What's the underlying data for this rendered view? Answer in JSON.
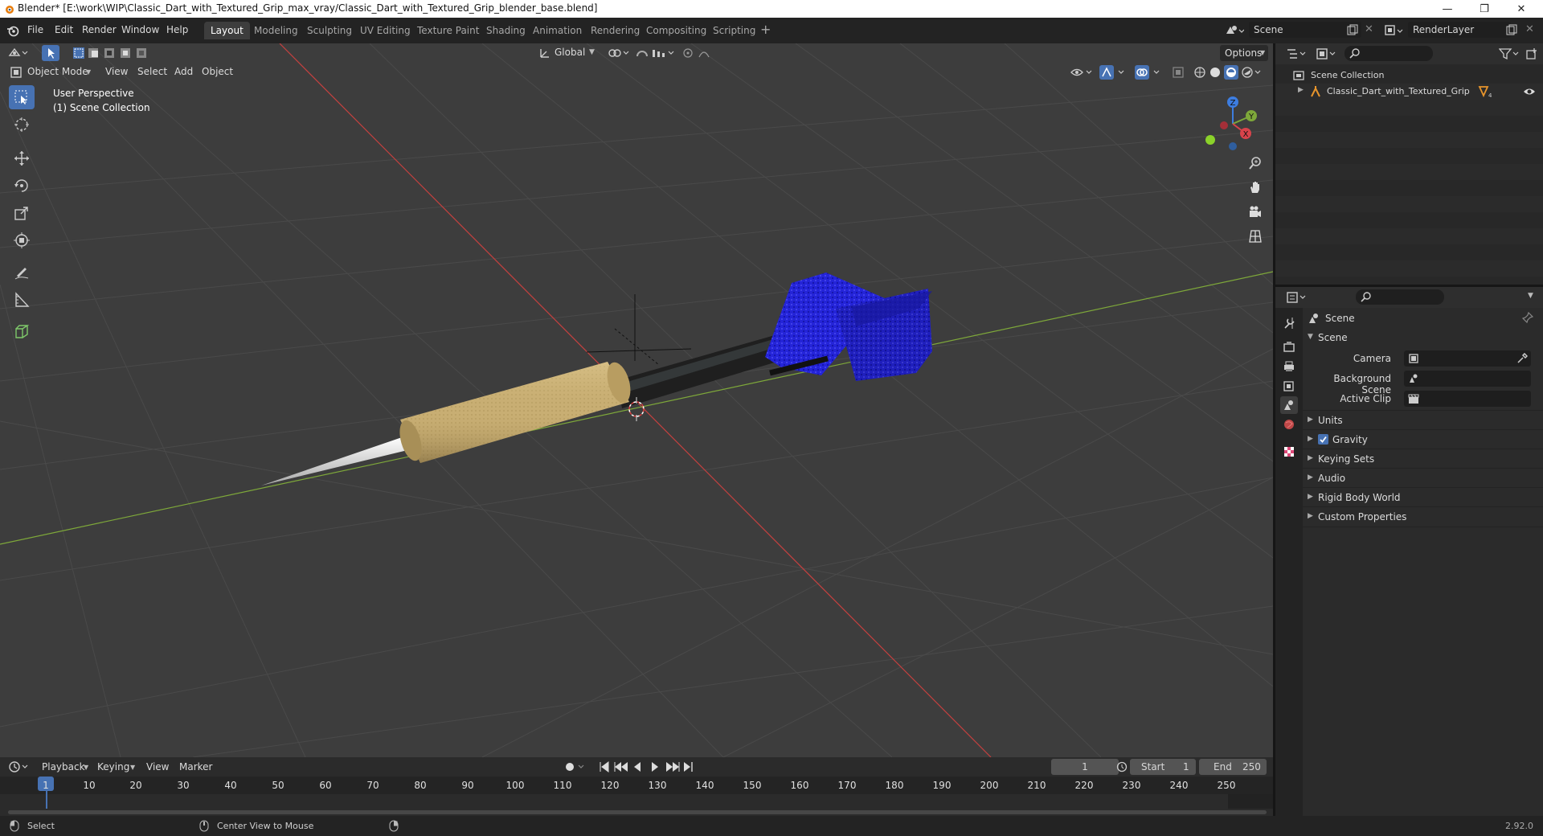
{
  "window": {
    "title": "Blender* [E:\\work\\WIP\\Classic_Dart_with_Textured_Grip_max_vray/Classic_Dart_with_Textured_Grip_blender_base.blend]",
    "controls": [
      "—",
      "❐",
      "✕"
    ]
  },
  "menu": {
    "items": [
      "File",
      "Edit",
      "Render",
      "Window",
      "Help"
    ]
  },
  "workspaces": {
    "tabs": [
      "Layout",
      "Modeling",
      "Sculpting",
      "UV Editing",
      "Texture Paint",
      "Shading",
      "Animation",
      "Rendering",
      "Compositing",
      "Scripting"
    ],
    "active": "Layout",
    "add_symbol": "+"
  },
  "scene_selector": {
    "value": "Scene"
  },
  "render_layer": {
    "value": "RenderLayer"
  },
  "viewport": {
    "mode": "Object Mode",
    "menus": [
      "View",
      "Select",
      "Add",
      "Object"
    ],
    "transform_orientation": "Global",
    "options_label": "Options",
    "overlay_line1": "User Perspective",
    "overlay_line2": "(1) Scene Collection",
    "gizmo_axes": {
      "z": "Z",
      "y": "Y",
      "x": "X"
    },
    "colors": {
      "background": "#3d3d3d",
      "x_axis": "#c5403f",
      "y_axis": "#7ea83a",
      "flight": "#2323d6",
      "grip": "#c7ad72"
    }
  },
  "outliner": {
    "root": "Scene Collection",
    "items": [
      "Classic_Dart_with_Textured_Grip"
    ]
  },
  "properties": {
    "context": "Scene",
    "panel_title": "Scene",
    "fields": {
      "camera": "Camera",
      "background_scene": "Background Scene",
      "active_clip": "Active Clip"
    },
    "sections": [
      "Units",
      "Gravity",
      "Keying Sets",
      "Audio",
      "Rigid Body World",
      "Custom Properties"
    ],
    "gravity_checked": true
  },
  "timeline": {
    "menus": [
      "Playback",
      "Keying",
      "View",
      "Marker"
    ],
    "current_frame": "1",
    "start_label": "Start",
    "start_value": "1",
    "end_label": "End",
    "end_value": "250",
    "ruler_labels": [
      "1",
      "10",
      "20",
      "30",
      "40",
      "50",
      "60",
      "70",
      "80",
      "90",
      "100",
      "110",
      "120",
      "130",
      "140",
      "150",
      "160",
      "170",
      "180",
      "190",
      "200",
      "210",
      "220",
      "230",
      "240",
      "250"
    ]
  },
  "statusbar": {
    "select_label": "Select",
    "center_label": "Center View to Mouse",
    "version": "2.92.0"
  }
}
